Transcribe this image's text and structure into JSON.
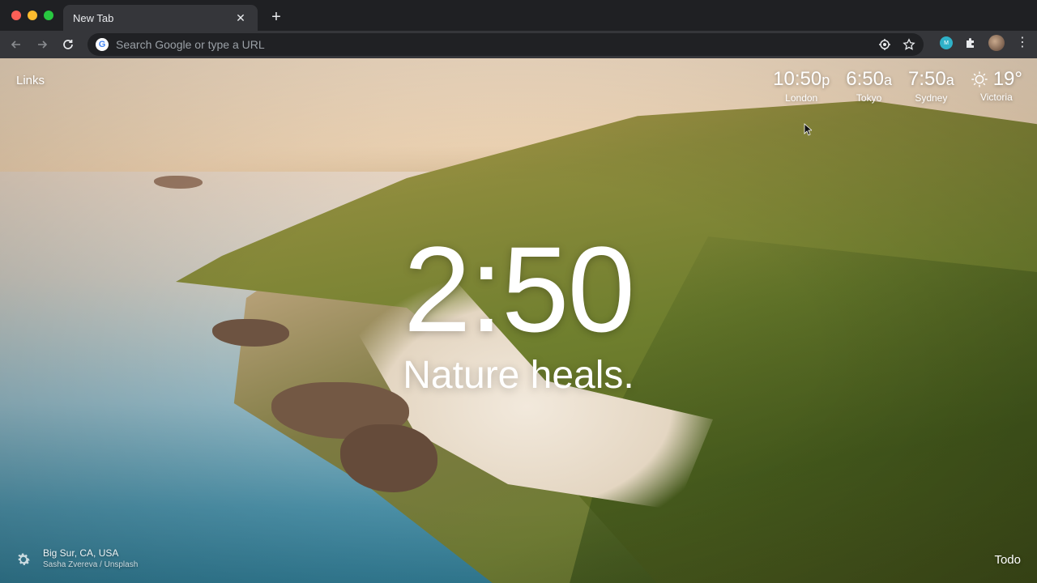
{
  "browser": {
    "tab": {
      "title": "New Tab",
      "close_icon": "close-icon"
    },
    "new_tab_label": "+",
    "omnibox": {
      "placeholder": "Search Google or type a URL"
    },
    "extensions": {
      "momentum_badge": "M"
    }
  },
  "dashboard": {
    "links_label": "Links",
    "world_clocks": [
      {
        "time": "10:50",
        "suffix": "p",
        "city": "London"
      },
      {
        "time": "6:50",
        "suffix": "a",
        "city": "Tokyo"
      },
      {
        "time": "7:50",
        "suffix": "a",
        "city": "Sydney"
      }
    ],
    "weather": {
      "icon": "sun-icon",
      "temperature": "19°",
      "location": "Victoria"
    },
    "clock": "2:50",
    "mantra": "Nature heals.",
    "photo": {
      "location": "Big Sur, CA, USA",
      "credit": "Sasha Zvereva / Unsplash"
    },
    "todo_label": "Todo"
  }
}
